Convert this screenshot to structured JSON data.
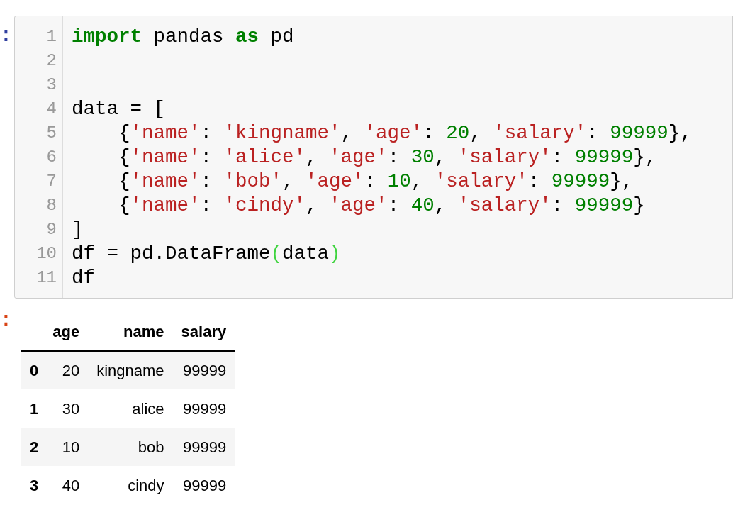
{
  "input_cell": {
    "prompt": ":",
    "lines": [
      {
        "number": "1",
        "tokens": [
          {
            "kind": "keyword",
            "text": "import"
          },
          {
            "kind": "plain",
            "text": " pandas "
          },
          {
            "kind": "keyword",
            "text": "as"
          },
          {
            "kind": "plain",
            "text": " pd"
          }
        ]
      },
      {
        "number": "2"
      },
      {
        "number": "3"
      },
      {
        "number": "4",
        "tokens": [
          {
            "kind": "plain",
            "text": "data = ["
          }
        ]
      },
      {
        "number": "5",
        "tokens": [
          {
            "kind": "plain",
            "text": "    {"
          },
          {
            "kind": "string",
            "text": "'name'"
          },
          {
            "kind": "plain",
            "text": ": "
          },
          {
            "kind": "string",
            "text": "'kingname'"
          },
          {
            "kind": "plain",
            "text": ", "
          },
          {
            "kind": "string",
            "text": "'age'"
          },
          {
            "kind": "plain",
            "text": ": "
          },
          {
            "kind": "number",
            "text": "20"
          },
          {
            "kind": "plain",
            "text": ", "
          },
          {
            "kind": "string",
            "text": "'salary'"
          },
          {
            "kind": "plain",
            "text": ": "
          },
          {
            "kind": "number",
            "text": "99999"
          },
          {
            "kind": "plain",
            "text": "},"
          }
        ]
      },
      {
        "number": "6",
        "tokens": [
          {
            "kind": "plain",
            "text": "    {"
          },
          {
            "kind": "string",
            "text": "'name'"
          },
          {
            "kind": "plain",
            "text": ": "
          },
          {
            "kind": "string",
            "text": "'alice'"
          },
          {
            "kind": "plain",
            "text": ", "
          },
          {
            "kind": "string",
            "text": "'age'"
          },
          {
            "kind": "plain",
            "text": ": "
          },
          {
            "kind": "number",
            "text": "30"
          },
          {
            "kind": "plain",
            "text": ", "
          },
          {
            "kind": "string",
            "text": "'salary'"
          },
          {
            "kind": "plain",
            "text": ": "
          },
          {
            "kind": "number",
            "text": "99999"
          },
          {
            "kind": "plain",
            "text": "},"
          }
        ]
      },
      {
        "number": "7",
        "tokens": [
          {
            "kind": "plain",
            "text": "    {"
          },
          {
            "kind": "string",
            "text": "'name'"
          },
          {
            "kind": "plain",
            "text": ": "
          },
          {
            "kind": "string",
            "text": "'bob'"
          },
          {
            "kind": "plain",
            "text": ", "
          },
          {
            "kind": "string",
            "text": "'age'"
          },
          {
            "kind": "plain",
            "text": ": "
          },
          {
            "kind": "number",
            "text": "10"
          },
          {
            "kind": "plain",
            "text": ", "
          },
          {
            "kind": "string",
            "text": "'salary'"
          },
          {
            "kind": "plain",
            "text": ": "
          },
          {
            "kind": "number",
            "text": "99999"
          },
          {
            "kind": "plain",
            "text": "},"
          }
        ]
      },
      {
        "number": "8",
        "tokens": [
          {
            "kind": "plain",
            "text": "    {"
          },
          {
            "kind": "string",
            "text": "'name'"
          },
          {
            "kind": "plain",
            "text": ": "
          },
          {
            "kind": "string",
            "text": "'cindy'"
          },
          {
            "kind": "plain",
            "text": ", "
          },
          {
            "kind": "string",
            "text": "'age'"
          },
          {
            "kind": "plain",
            "text": ": "
          },
          {
            "kind": "number",
            "text": "40"
          },
          {
            "kind": "plain",
            "text": ", "
          },
          {
            "kind": "string",
            "text": "'salary'"
          },
          {
            "kind": "plain",
            "text": ": "
          },
          {
            "kind": "number",
            "text": "99999"
          },
          {
            "kind": "plain",
            "text": "}"
          }
        ]
      },
      {
        "number": "9",
        "tokens": [
          {
            "kind": "plain",
            "text": "]"
          }
        ]
      },
      {
        "number": "10",
        "tokens": [
          {
            "kind": "plain",
            "text": "df = pd.DataFrame"
          },
          {
            "kind": "bracket-match",
            "text": "("
          },
          {
            "kind": "plain",
            "text": "data"
          },
          {
            "kind": "bracket-match",
            "text": ")"
          }
        ]
      },
      {
        "number": "11",
        "tokens": [
          {
            "kind": "plain",
            "text": "df"
          }
        ]
      }
    ]
  },
  "output_cell": {
    "prompt": ":",
    "table": {
      "columns": [
        "age",
        "name",
        "salary"
      ],
      "rows": [
        {
          "index": "0",
          "cells": [
            "20",
            "kingname",
            "99999"
          ]
        },
        {
          "index": "1",
          "cells": [
            "30",
            "alice",
            "99999"
          ]
        },
        {
          "index": "2",
          "cells": [
            "10",
            "bob",
            "99999"
          ]
        },
        {
          "index": "3",
          "cells": [
            "40",
            "cindy",
            "99999"
          ]
        }
      ]
    }
  }
}
